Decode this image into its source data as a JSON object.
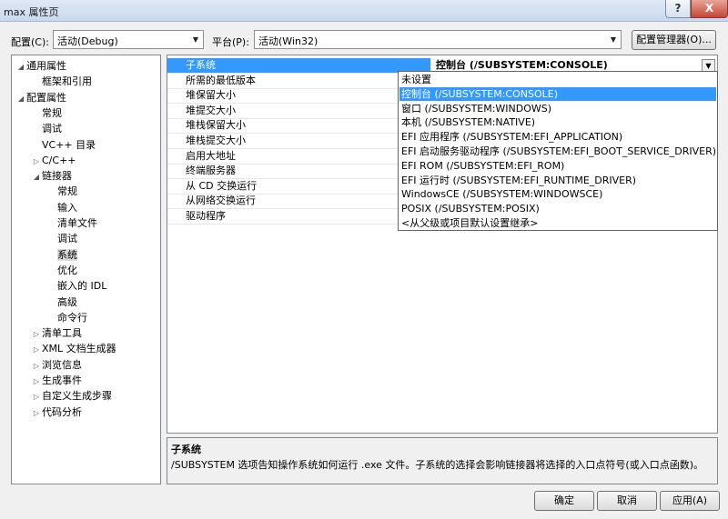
{
  "window": {
    "title": "max 属性页",
    "help_glyph": "?",
    "close_glyph": "X"
  },
  "config_row": {
    "config_label": "配置(C):",
    "config_value": "活动(Debug)",
    "platform_label": "平台(P):",
    "platform_value": "活动(Win32)",
    "manager_button": "配置管理器(O)..."
  },
  "tree": {
    "items": [
      {
        "label": "通用属性",
        "level": 0,
        "expander": "open"
      },
      {
        "label": "框架和引用",
        "level": 1,
        "expander": "none"
      },
      {
        "label": "配置属性",
        "level": 0,
        "expander": "open"
      },
      {
        "label": "常规",
        "level": 1,
        "expander": "none"
      },
      {
        "label": "调试",
        "level": 1,
        "expander": "none"
      },
      {
        "label": "VC++ 目录",
        "level": 1,
        "expander": "none"
      },
      {
        "label": "C/C++",
        "level": 1,
        "expander": "closed"
      },
      {
        "label": "链接器",
        "level": 1,
        "expander": "open"
      },
      {
        "label": "常规",
        "level": 2,
        "expander": "none"
      },
      {
        "label": "输入",
        "level": 2,
        "expander": "none"
      },
      {
        "label": "清单文件",
        "level": 2,
        "expander": "none"
      },
      {
        "label": "调试",
        "level": 2,
        "expander": "none"
      },
      {
        "label": "系统",
        "level": 2,
        "expander": "none",
        "selected": true
      },
      {
        "label": "优化",
        "level": 2,
        "expander": "none"
      },
      {
        "label": "嵌入的 IDL",
        "level": 2,
        "expander": "none"
      },
      {
        "label": "高级",
        "level": 2,
        "expander": "none"
      },
      {
        "label": "命令行",
        "level": 2,
        "expander": "none"
      },
      {
        "label": "清单工具",
        "level": 1,
        "expander": "closed"
      },
      {
        "label": "XML 文档生成器",
        "level": 1,
        "expander": "closed"
      },
      {
        "label": "浏览信息",
        "level": 1,
        "expander": "closed"
      },
      {
        "label": "生成事件",
        "level": 1,
        "expander": "closed"
      },
      {
        "label": "自定义生成步骤",
        "level": 1,
        "expander": "closed"
      },
      {
        "label": "代码分析",
        "level": 1,
        "expander": "closed"
      }
    ]
  },
  "grid": {
    "rows": [
      {
        "name": "子系统",
        "value": "控制台 (/SUBSYSTEM:CONSOLE)"
      },
      {
        "name": "所需的最低版本",
        "value": ""
      },
      {
        "name": "堆保留大小",
        "value": ""
      },
      {
        "name": "堆提交大小",
        "value": ""
      },
      {
        "name": "堆栈保留大小",
        "value": ""
      },
      {
        "name": "堆栈提交大小",
        "value": ""
      },
      {
        "name": "启用大地址",
        "value": ""
      },
      {
        "name": "终端服务器",
        "value": ""
      },
      {
        "name": "从 CD 交换运行",
        "value": ""
      },
      {
        "name": "从网络交换运行",
        "value": ""
      },
      {
        "name": "驱动程序",
        "value": ""
      }
    ]
  },
  "dropdown": {
    "options": [
      "未设置",
      "控制台 (/SUBSYSTEM:CONSOLE)",
      "窗口 (/SUBSYSTEM:WINDOWS)",
      "本机 (/SUBSYSTEM:NATIVE)",
      "EFI 应用程序 (/SUBSYSTEM:EFI_APPLICATION)",
      "EFI 启动服务驱动程序 (/SUBSYSTEM:EFI_BOOT_SERVICE_DRIVER)",
      "EFI ROM (/SUBSYSTEM:EFI_ROM)",
      "EFI 运行时 (/SUBSYSTEM:EFI_RUNTIME_DRIVER)",
      "WindowsCE (/SUBSYSTEM:WINDOWSCE)",
      "POSIX (/SUBSYSTEM:POSIX)",
      "<从父级或项目默认设置继承>"
    ],
    "selected_index": 1
  },
  "description": {
    "title": "子系统",
    "text": "/SUBSYSTEM 选项告知操作系统如何运行 .exe 文件。子系统的选择会影响链接器将选择的入口点符号(或入口点函数)。"
  },
  "buttons": {
    "ok": "确定",
    "cancel": "取消",
    "apply": "应用(A)"
  }
}
